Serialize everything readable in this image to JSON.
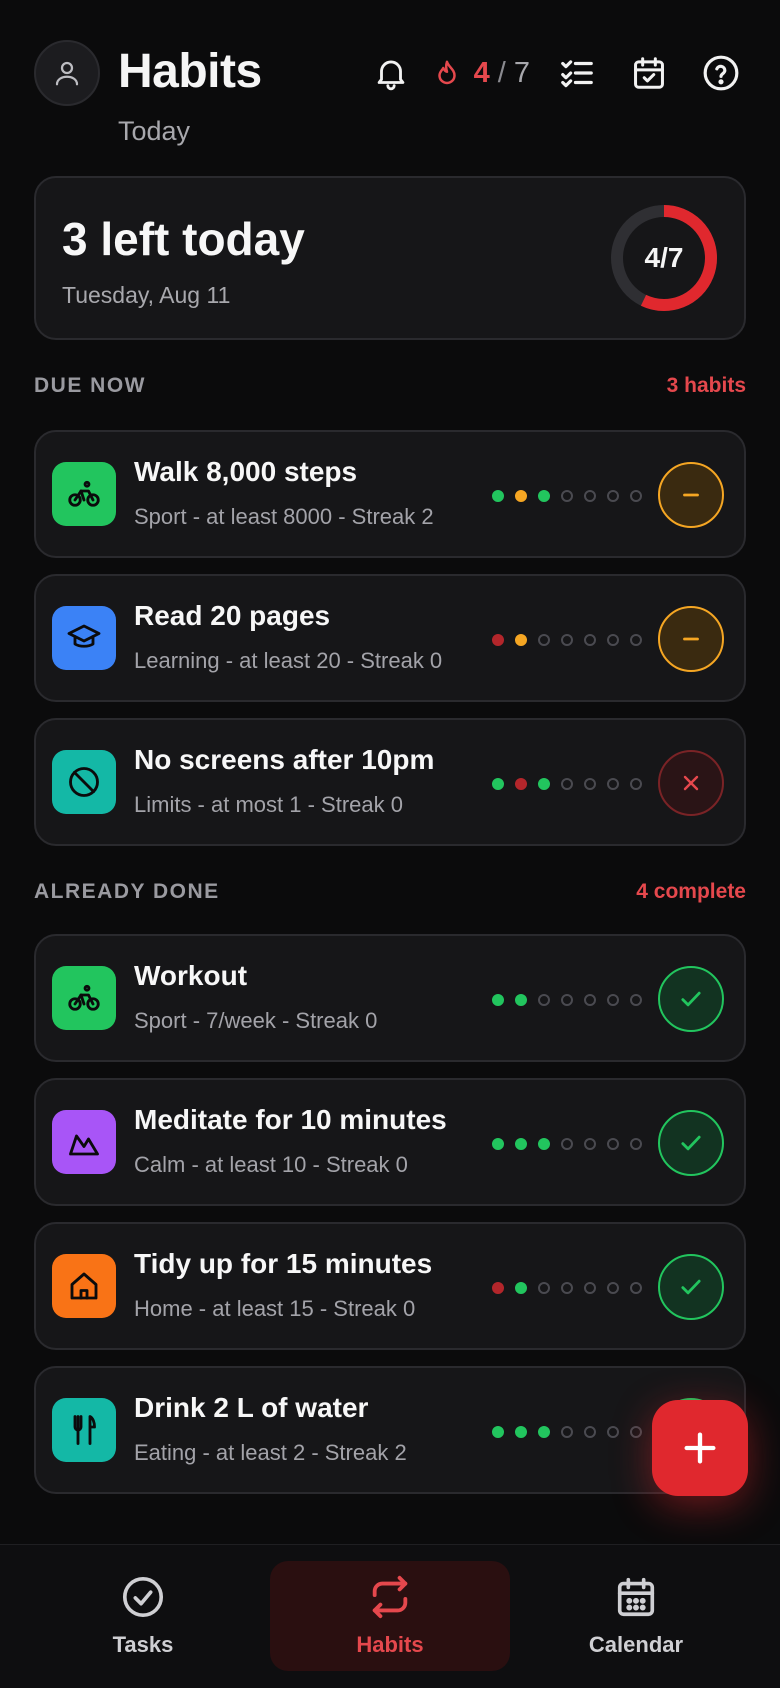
{
  "header": {
    "title": "Habits",
    "subtitle": "Today",
    "streak_done": "4",
    "streak_sep": "/",
    "streak_total": "7"
  },
  "summary": {
    "title": "3 left today",
    "date": "Tuesday, Aug 11",
    "ring_label": "4/7",
    "progress": 0.571
  },
  "sections": {
    "due": {
      "title": "DUE NOW",
      "count": "3 habits"
    },
    "done": {
      "title": "ALREADY DONE",
      "count": "4 complete"
    }
  },
  "due_habits": [
    {
      "title": "Walk 8,000 steps",
      "sub": "Sport - at least 8000 - Streak 2",
      "icon": "bicycle-icon",
      "icon_color": "#22c55e",
      "dots": [
        "g",
        "o",
        "g",
        "e",
        "e",
        "e",
        "e"
      ],
      "action": "minus"
    },
    {
      "title": "Read 20 pages",
      "sub": "Learning - at least 20 - Streak 0",
      "icon": "graduation-cap-icon",
      "icon_color": "#3b82f6",
      "dots": [
        "r",
        "o",
        "e",
        "e",
        "e",
        "e",
        "e"
      ],
      "action": "minus"
    },
    {
      "title": "No screens after 10pm",
      "sub": "Limits - at most 1 - Streak 0",
      "icon": "prohibited-icon",
      "icon_color": "#14b8a6",
      "dots": [
        "g",
        "r",
        "g",
        "e",
        "e",
        "e",
        "e"
      ],
      "action": "x"
    }
  ],
  "done_habits": [
    {
      "title": "Workout",
      "sub": "Sport - 7/week - Streak 0",
      "icon": "bicycle-icon",
      "icon_color": "#22c55e",
      "dots": [
        "g",
        "g",
        "e",
        "e",
        "e",
        "e",
        "e"
      ],
      "action": "check"
    },
    {
      "title": "Meditate for 10 minutes",
      "sub": "Calm - at least 10 - Streak 0",
      "icon": "mountain-icon",
      "icon_color": "#a855f7",
      "dots": [
        "g",
        "g",
        "g",
        "e",
        "e",
        "e",
        "e"
      ],
      "action": "check"
    },
    {
      "title": "Tidy up for 15 minutes",
      "sub": "Home - at least 15 - Streak 0",
      "icon": "home-icon",
      "icon_color": "#f97316",
      "dots": [
        "r",
        "g",
        "e",
        "e",
        "e",
        "e",
        "e"
      ],
      "action": "check"
    },
    {
      "title": "Drink 2 L of water",
      "sub": "Eating - at least 2 - Streak 2",
      "icon": "utensils-icon",
      "icon_color": "#14b8a6",
      "dots": [
        "g",
        "g",
        "g",
        "e",
        "e",
        "e",
        "e"
      ],
      "action": "check"
    }
  ],
  "nav": {
    "tasks": "Tasks",
    "habits": "Habits",
    "calendar": "Calendar"
  },
  "colors": {
    "accent": "#e5484d",
    "success": "#22c55e",
    "warning": "#f5a623"
  }
}
